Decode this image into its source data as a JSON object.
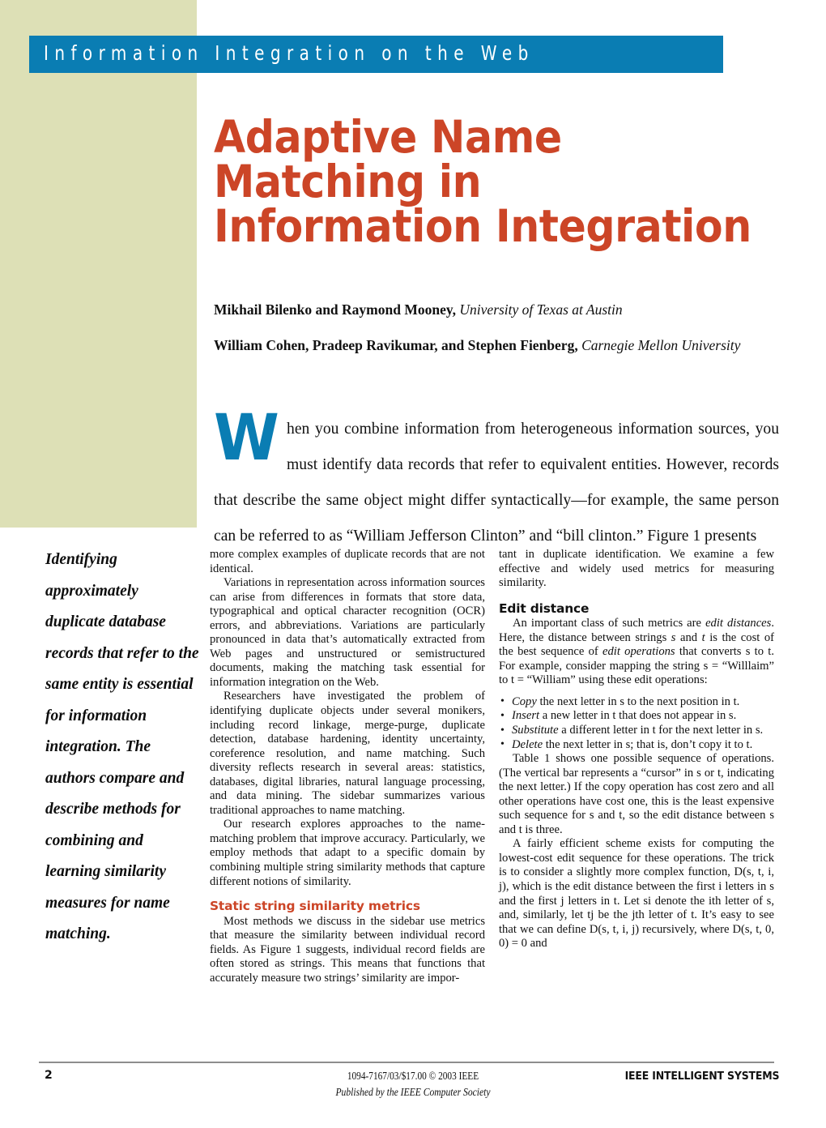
{
  "banner": {
    "text": "Information Integration on the Web",
    "background_color": "#0a7db3",
    "text_color": "#ffffff"
  },
  "title": {
    "color": "#cc4527",
    "lines": [
      "Adaptive Name",
      "Matching in",
      "Information Integration"
    ],
    "full": "Adaptive Name Matching in Information Integration"
  },
  "authors": {
    "line1_names": "Mikhail Bilenko and Raymond Mooney,",
    "line1_affiliation": "University of Texas at Austin",
    "line2_names": "William Cohen, Pradeep Ravikumar, and Stephen Fienberg,",
    "line2_affiliation": "Carnegie Mellon University"
  },
  "lead": {
    "dropcap": "W",
    "text": "hen you combine information from heterogeneous information sources, you must identify data records that refer to equivalent entities. However, records that describe the same object might differ syntactically—for example, the same person can be referred to as “William Jefferson Clinton” and “bill clinton.” Figure 1 presents"
  },
  "pullquote": {
    "text": "Identifying approximately duplicate database records that refer to the same entity is essential for information integration. The authors compare and describe methods for combining and learning similarity measures for name matching."
  },
  "middle_column": {
    "para1": "more complex examples of duplicate records that are not identical.",
    "para2": "Variations in representation across information sources can arise from differences in formats that store data, typographical and optical character recognition (OCR) errors, and abbreviations. Variations are particularly pronounced in data that’s automatically extracted from Web pages and unstructured or semistructured documents, making the matching task essential for information integration on the Web.",
    "para3": "Researchers have investigated the problem of identifying duplicate objects under several monikers, including record linkage, merge-purge, duplicate detection, database hardening, identity uncertainty, coreference resolution, and name matching. Such diversity reflects research in several areas: statistics, databases, digital libraries, natural language processing, and data mining. The sidebar summarizes various traditional approaches to name matching.",
    "para4": "Our research explores approaches to the name-matching problem that improve accuracy. Particularly, we employ methods that adapt to a specific domain by combining multiple string similarity methods that capture different notions of similarity.",
    "heading": "Static string similarity metrics",
    "heading_color": "#cc4527",
    "para5": "Most methods we discuss in the sidebar use metrics that measure the similarity between individual record fields. As Figure 1 suggests, individual record fields are often stored as strings. This means that functions that accurately measure two strings’ similarity are impor-"
  },
  "right_column": {
    "para1": "tant in duplicate identification. We examine a few effective and widely used metrics for measuring similarity.",
    "heading": "Edit distance",
    "heading_color": "#111111",
    "para2_pre": "An important class of such metrics are ",
    "para2_em1": "edit distances",
    "para2_mid": ". Here, the distance between strings ",
    "para2_s": "s",
    "para2_mid2": " and ",
    "para2_t": "t",
    "para2_mid3": " is the cost of the best sequence of ",
    "para2_em2": "edit operations",
    "para2_post": " that converts s to t. For example, consider mapping the string s = “Willlaim” to t = “William” using these edit operations:",
    "bullets": [
      {
        "op": "Copy",
        "rest": " the next letter in s to the next position in t."
      },
      {
        "op": "Insert",
        "rest": " a new letter in t that does not appear in s."
      },
      {
        "op": "Substitute",
        "rest": " a different letter in t for the next letter in s."
      },
      {
        "op": "Delete",
        "rest": " the next letter in s; that is, don’t copy it to t."
      }
    ],
    "para3": "Table 1 shows one possible sequence of operations. (The vertical bar represents a “cursor” in s or t, indicating the next letter.) If the copy operation has cost zero and all other operations have cost one, this is the least expensive such sequence for s and t, so the edit distance between s and t is three.",
    "para4": "A fairly efficient scheme exists for computing the lowest-cost edit sequence for these operations. The trick is to consider a slightly more complex function, D(s, t, i, j), which is the edit distance between the first i letters in s and the first j letters in t. Let si denote the ith letter of s, and, similarly, let tj be the jth letter of t. It’s easy to see that we can define D(s, t, i, j) recursively, where D(s, t, 0, 0) = 0 and"
  },
  "footer": {
    "page_number": "2",
    "copyright": "1094-7167/03/$17.00 © 2003 IEEE",
    "publisher": "Published by the IEEE Computer Society",
    "journal": "IEEE INTELLIGENT SYSTEMS"
  },
  "colors": {
    "beige_panel": "#dde0b6",
    "banner_blue": "#0a7db3",
    "accent_orange": "#cc4527",
    "dropcap_blue": "#0a7db3"
  }
}
